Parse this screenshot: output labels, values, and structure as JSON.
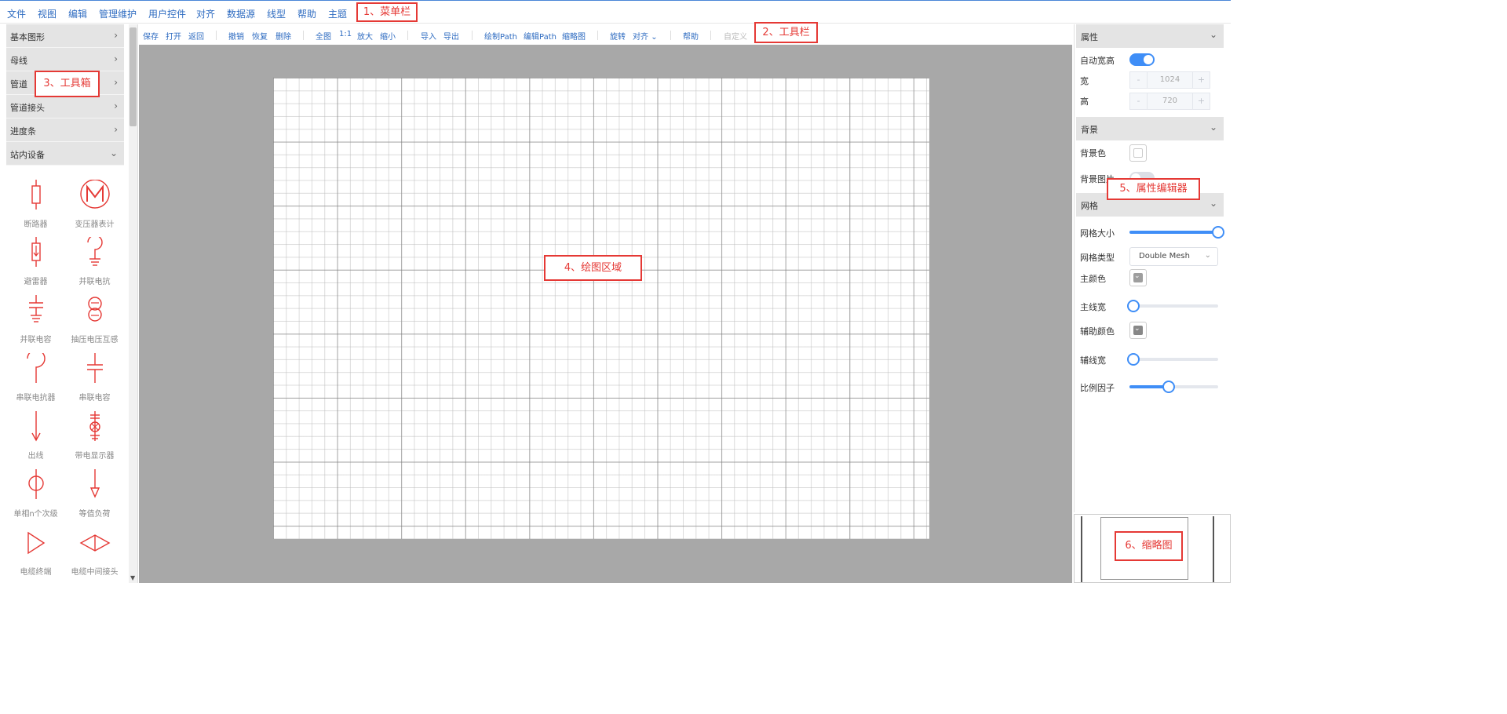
{
  "menubar": {
    "items": [
      "文件",
      "视图",
      "编辑",
      "管理维护",
      "用户控件",
      "对齐",
      "数据源",
      "线型",
      "帮助",
      "主题"
    ]
  },
  "toolbar": {
    "save": "保存",
    "open": "打开",
    "back": "返回",
    "undo": "撤销",
    "redo": "恢复",
    "delete": "删除",
    "fit": "全图",
    "actual": "1:1",
    "zoom_in": "放大",
    "zoom_out": "缩小",
    "import": "导入",
    "export": "导出",
    "draw_path": "绘制Path",
    "edit_path": "编辑Path",
    "thumbnail": "缩略图",
    "rotate": "旋转",
    "align": "对齐",
    "help": "帮助",
    "custom": "自定义"
  },
  "toolbox": {
    "categories": [
      "基本图形",
      "母线",
      "管道",
      "管道接头",
      "进度条",
      "站内设备"
    ],
    "tools": [
      "断路器",
      "变压器表计",
      "避雷器",
      "并联电抗",
      "并联电容",
      "抽压电压互感",
      "串联电抗器",
      "串联电容",
      "出线",
      "带电显示器",
      "单相n个次级",
      "等值负荷",
      "电缆终端",
      "电缆中间接头"
    ]
  },
  "properties": {
    "sections": {
      "attributes": "属性",
      "background": "背景",
      "grid": "网格"
    },
    "auto_size": {
      "label": "自动宽高",
      "on": true
    },
    "width": {
      "label": "宽",
      "value": "1024"
    },
    "height": {
      "label": "高",
      "value": "720"
    },
    "bg_color": {
      "label": "背景色",
      "value": "#ffffff"
    },
    "bg_image": {
      "label": "背景图片",
      "on": false
    },
    "grid_size": {
      "label": "网格大小",
      "level": 1.0
    },
    "grid_type": {
      "label": "网格类型",
      "value": "Double Mesh"
    },
    "main_color": {
      "label": "主颜色",
      "value": "#9e9e9e"
    },
    "main_width": {
      "label": "主线宽",
      "level": 0.0
    },
    "aux_color": {
      "label": "辅助颜色",
      "value": "#888888"
    },
    "aux_width": {
      "label": "辅线宽",
      "level": 0.0
    },
    "scale": {
      "label": "比例因子",
      "level": 0.44
    },
    "stepper_minus": "-",
    "stepper_plus": "+"
  },
  "callouts": {
    "menubar": "1、菜单栏",
    "toolbar": "2、工具栏",
    "toolbox": "3、工具箱",
    "canvas": "4、绘图区域",
    "props": "5、属性编辑器",
    "minimap": "6、缩略图"
  },
  "colors": {
    "accent": "#3f8ef7",
    "link": "#2f6cc1",
    "symbol": "#e53935",
    "canvas_bg": "#a8a8a8"
  }
}
